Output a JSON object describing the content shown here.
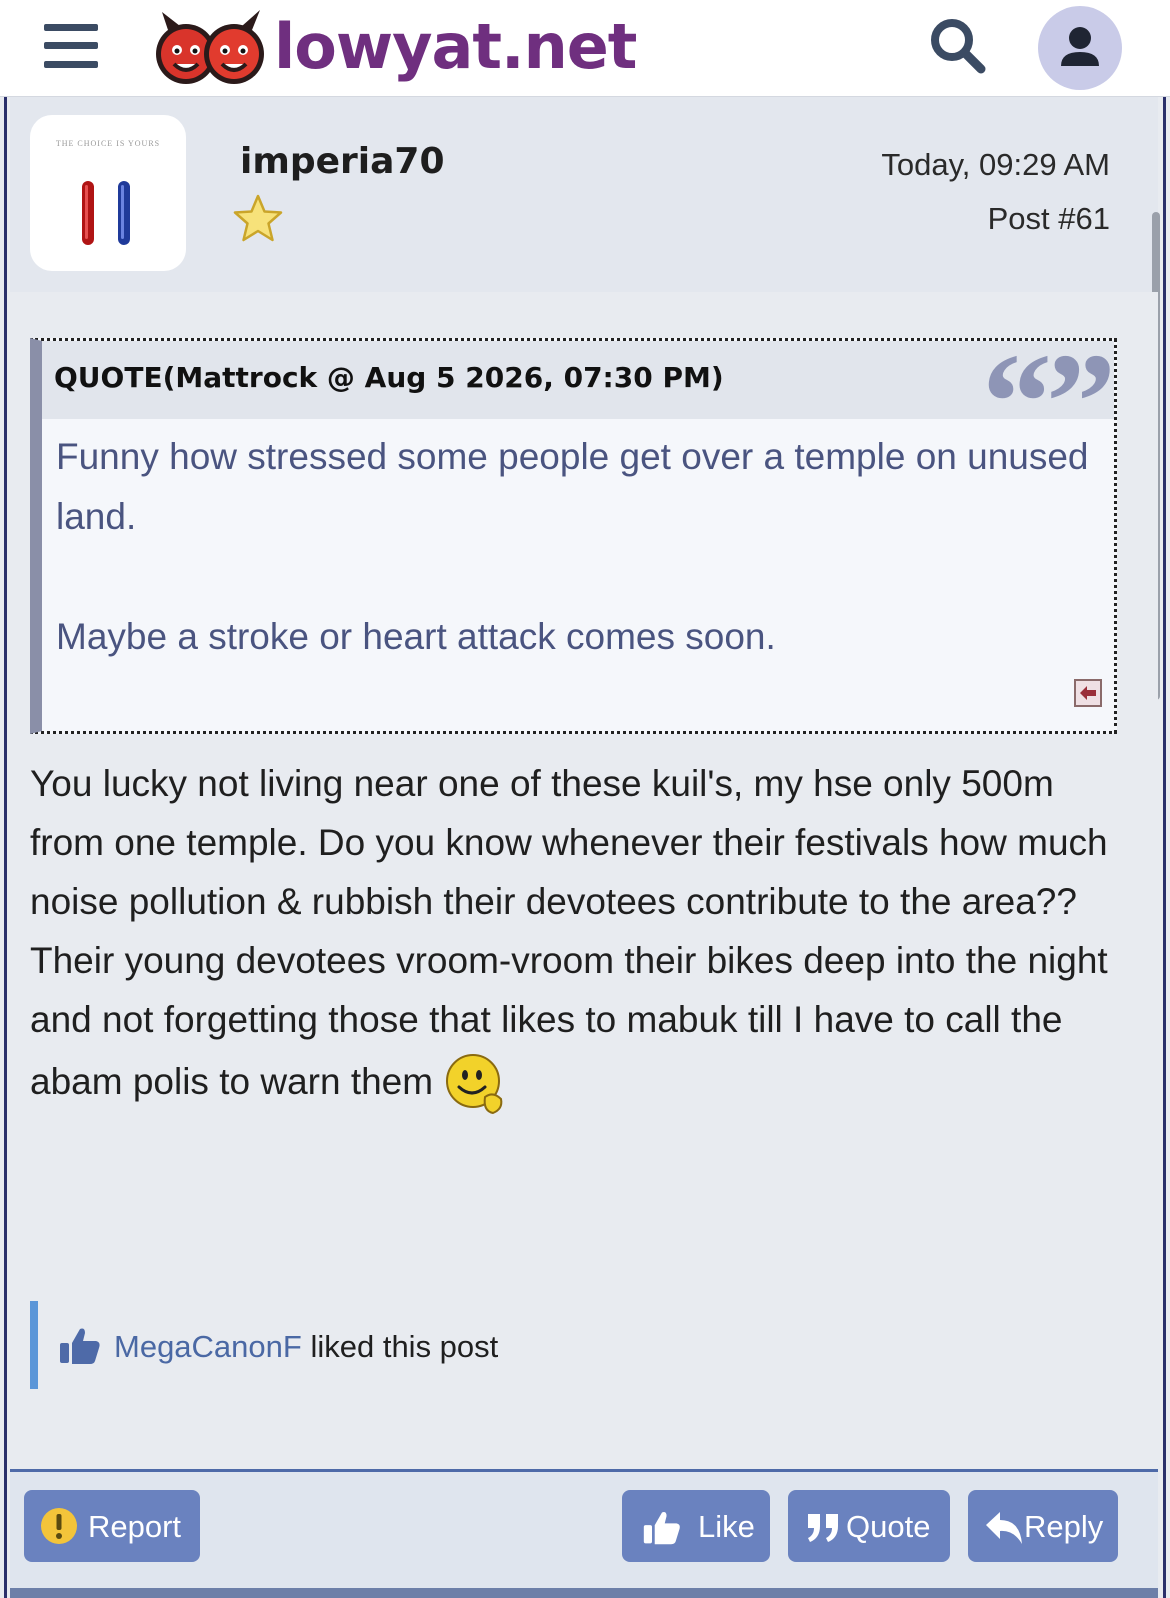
{
  "header": {
    "site_name": "lowyat.net"
  },
  "post": {
    "username": "imperia70",
    "avatar_caption": "THE CHOICE IS YOURS",
    "timestamp": "Today, 09:29 AM",
    "post_number": "Post #61",
    "quote": {
      "title": "QUOTE(Mattrock @ Aug 5 2026, 07:30 PM)",
      "text": "Funny how stressed some people get over a temple on unused land.\n\nMaybe a stroke or heart attack comes soon."
    },
    "body_lines": [
      "You lucky not living near one of these kuil's, my hse only 500m from one temple. Do you know whenever their festivals how much",
      "noise pollution & rubbish their devotees contribute to the area?? Their young devotees vroom-vroom their bikes deep into the night",
      "and not forgetting those that likes to mabuk till I have to call the abam polis to warn them"
    ],
    "liked_by": "MegaCanonF",
    "liked_suffix": " liked this post"
  },
  "actions": {
    "report": "Report",
    "like": "Like",
    "quote": "Quote",
    "reply": "Reply"
  },
  "colors": {
    "accent": "#6a82bf",
    "brand": "#6f2f7f",
    "quote_text": "#4a5480"
  }
}
